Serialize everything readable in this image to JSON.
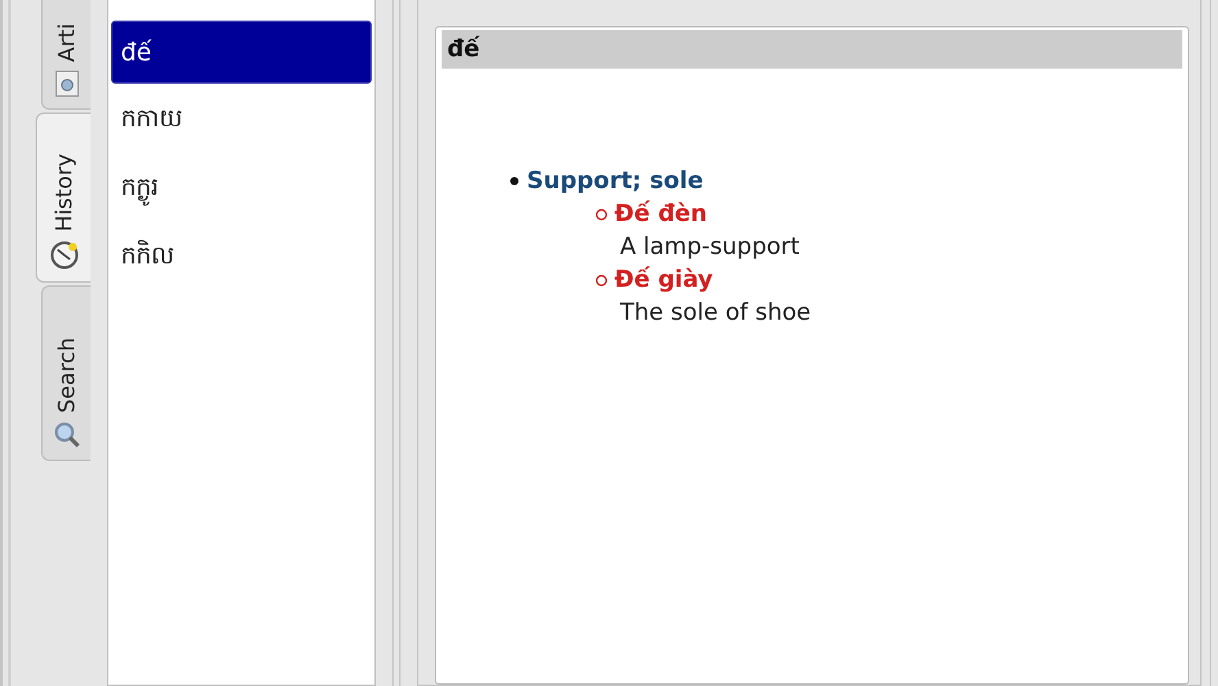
{
  "tabs": [
    {
      "label": "Arti",
      "kind": "article",
      "selected": false
    },
    {
      "label": "History",
      "kind": "history",
      "selected": true
    },
    {
      "label": "Search",
      "kind": "search",
      "selected": false
    }
  ],
  "history": [
    {
      "word": "đế",
      "selected": true
    },
    {
      "word": "កកាយ",
      "selected": false
    },
    {
      "word": "កក្ងូរ",
      "selected": false
    },
    {
      "word": "កកិល",
      "selected": false
    }
  ],
  "article": {
    "headword": "đế",
    "senses": [
      {
        "meaning": "Support; sole",
        "examples": [
          {
            "term": "Đế đèn",
            "gloss": "A lamp-support"
          },
          {
            "term": "Đế giày",
            "gloss": "The sole of shoe"
          }
        ]
      }
    ]
  }
}
